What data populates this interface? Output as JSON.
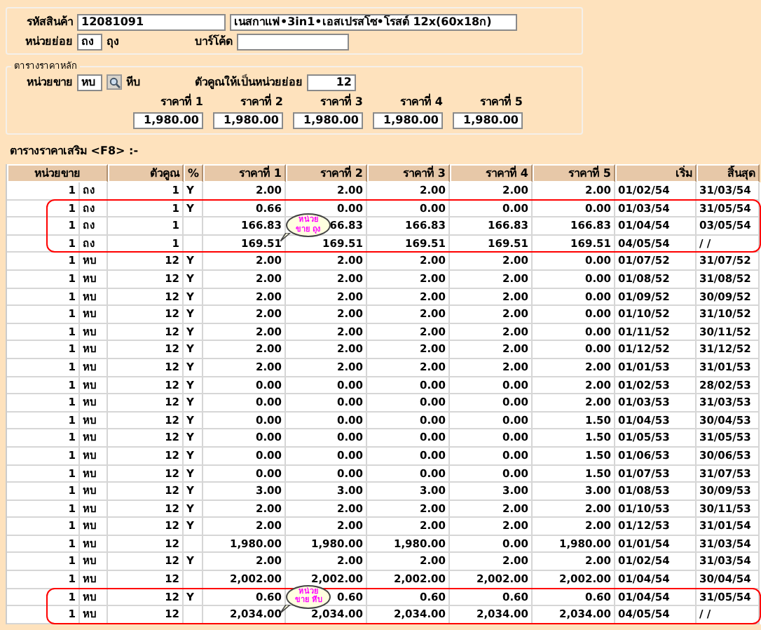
{
  "product": {
    "code_label": "รหัสสินค้า",
    "code": "12081091",
    "name": "เนสกาแฟ•3in1•เอสเปรสโซ•โรสต์ 12x(60x18ก)",
    "subunit_label": "หน่วยย่อย",
    "subunit_code": "ถง",
    "subunit_name": "ถุง",
    "barcode_label": "บาร์โค้ด"
  },
  "main_price": {
    "legend": "ตารางราคาหลัก",
    "unit_label": "หน่วยขาย",
    "unit_code": "หบ",
    "unit_name": "หีบ",
    "multiplier_label": "ตัวคูณให้เป็นหน่วยย่อย",
    "multiplier": "12",
    "prices": [
      {
        "label": "ราคาที่ 1",
        "value": "1,980.00"
      },
      {
        "label": "ราคาที่ 2",
        "value": "1,980.00"
      },
      {
        "label": "ราคาที่ 3",
        "value": "1,980.00"
      },
      {
        "label": "ราคาที่ 4",
        "value": "1,980.00"
      },
      {
        "label": "ราคาที่ 5",
        "value": "1,980.00"
      }
    ]
  },
  "extra_title": "ตารางราคาเสริม <F8> :-",
  "table": {
    "columns": [
      "หน่วยขาย",
      "ตัวคูณ",
      "%",
      "ราคาที่ 1",
      "ราคาที่ 2",
      "ราคาที่ 3",
      "ราคาที่ 4",
      "ราคาที่ 5",
      "เริ่ม",
      "สิ้นสุด"
    ],
    "rows": [
      {
        "qty": "1",
        "unit": "ถง",
        "mult": "1",
        "pct": "Y",
        "p": [
          "2.00",
          "2.00",
          "2.00",
          "2.00",
          "2.00"
        ],
        "start": "01/02/54",
        "end": "31/03/54",
        "outlined": false
      },
      {
        "qty": "1",
        "unit": "ถง",
        "mult": "1",
        "pct": "Y",
        "p": [
          "0.66",
          "0.00",
          "0.00",
          "0.00",
          "0.00"
        ],
        "start": "01/03/54",
        "end": "31/05/54",
        "outlined": true
      },
      {
        "qty": "1",
        "unit": "ถง",
        "mult": "1",
        "p": [
          "166.83",
          "66.83",
          "166.83",
          "166.83",
          "166.83"
        ],
        "start": "01/04/54",
        "end": "03/05/54",
        "outlined": true
      },
      {
        "qty": "1",
        "unit": "ถง",
        "mult": "1",
        "p": [
          "169.51",
          "169.51",
          "169.51",
          "169.51",
          "169.51"
        ],
        "start": "04/05/54",
        "end": "/  /",
        "outlined": true
      },
      {
        "qty": "1",
        "unit": "หบ",
        "mult": "12",
        "pct": "Y",
        "p": [
          "2.00",
          "2.00",
          "2.00",
          "2.00",
          "0.00"
        ],
        "start": "01/07/52",
        "end": "31/07/52",
        "outlined": false
      },
      {
        "qty": "1",
        "unit": "หบ",
        "mult": "12",
        "pct": "Y",
        "p": [
          "2.00",
          "2.00",
          "2.00",
          "2.00",
          "0.00"
        ],
        "start": "01/08/52",
        "end": "31/08/52",
        "outlined": false
      },
      {
        "qty": "1",
        "unit": "หบ",
        "mult": "12",
        "pct": "Y",
        "p": [
          "2.00",
          "2.00",
          "2.00",
          "2.00",
          "0.00"
        ],
        "start": "01/09/52",
        "end": "30/09/52",
        "outlined": false
      },
      {
        "qty": "1",
        "unit": "หบ",
        "mult": "12",
        "pct": "Y",
        "p": [
          "2.00",
          "2.00",
          "2.00",
          "2.00",
          "0.00"
        ],
        "start": "01/10/52",
        "end": "31/10/52",
        "outlined": false
      },
      {
        "qty": "1",
        "unit": "หบ",
        "mult": "12",
        "pct": "Y",
        "p": [
          "2.00",
          "2.00",
          "2.00",
          "2.00",
          "0.00"
        ],
        "start": "01/11/52",
        "end": "30/11/52",
        "outlined": false
      },
      {
        "qty": "1",
        "unit": "หบ",
        "mult": "12",
        "pct": "Y",
        "p": [
          "2.00",
          "2.00",
          "2.00",
          "2.00",
          "0.00"
        ],
        "start": "01/12/52",
        "end": "31/12/52",
        "outlined": false
      },
      {
        "qty": "1",
        "unit": "หบ",
        "mult": "12",
        "pct": "Y",
        "p": [
          "2.00",
          "2.00",
          "2.00",
          "2.00",
          "2.00"
        ],
        "start": "01/01/53",
        "end": "31/01/53",
        "outlined": false
      },
      {
        "qty": "1",
        "unit": "หบ",
        "mult": "12",
        "pct": "Y",
        "p": [
          "0.00",
          "0.00",
          "0.00",
          "0.00",
          "2.00"
        ],
        "start": "01/02/53",
        "end": "28/02/53",
        "outlined": false
      },
      {
        "qty": "1",
        "unit": "หบ",
        "mult": "12",
        "pct": "Y",
        "p": [
          "0.00",
          "0.00",
          "0.00",
          "0.00",
          "2.00"
        ],
        "start": "01/03/53",
        "end": "31/03/53",
        "outlined": false
      },
      {
        "qty": "1",
        "unit": "หบ",
        "mult": "12",
        "pct": "Y",
        "p": [
          "0.00",
          "0.00",
          "0.00",
          "0.00",
          "1.50"
        ],
        "start": "01/04/53",
        "end": "30/04/53",
        "outlined": false
      },
      {
        "qty": "1",
        "unit": "หบ",
        "mult": "12",
        "pct": "Y",
        "p": [
          "0.00",
          "0.00",
          "0.00",
          "0.00",
          "1.50"
        ],
        "start": "01/05/53",
        "end": "31/05/53",
        "outlined": false
      },
      {
        "qty": "1",
        "unit": "หบ",
        "mult": "12",
        "pct": "Y",
        "p": [
          "0.00",
          "0.00",
          "0.00",
          "0.00",
          "1.50"
        ],
        "start": "01/06/53",
        "end": "30/06/53",
        "outlined": false
      },
      {
        "qty": "1",
        "unit": "หบ",
        "mult": "12",
        "pct": "Y",
        "p": [
          "0.00",
          "0.00",
          "0.00",
          "0.00",
          "1.50"
        ],
        "start": "01/07/53",
        "end": "31/07/53",
        "outlined": false
      },
      {
        "qty": "1",
        "unit": "หบ",
        "mult": "12",
        "pct": "Y",
        "p": [
          "3.00",
          "3.00",
          "3.00",
          "3.00",
          "3.00"
        ],
        "start": "01/08/53",
        "end": "30/09/53",
        "outlined": false
      },
      {
        "qty": "1",
        "unit": "หบ",
        "mult": "12",
        "pct": "Y",
        "p": [
          "2.00",
          "2.00",
          "2.00",
          "2.00",
          "2.00"
        ],
        "start": "01/10/53",
        "end": "30/11/53",
        "outlined": false
      },
      {
        "qty": "1",
        "unit": "หบ",
        "mult": "12",
        "pct": "Y",
        "p": [
          "2.00",
          "2.00",
          "2.00",
          "2.00",
          "2.00"
        ],
        "start": "01/12/53",
        "end": "31/01/54",
        "outlined": false
      },
      {
        "qty": "1",
        "unit": "หบ",
        "mult": "12",
        "p": [
          "1,980.00",
          "1,980.00",
          "1,980.00",
          "0.00",
          "1,980.00"
        ],
        "start": "01/01/54",
        "end": "31/03/54",
        "outlined": false
      },
      {
        "qty": "1",
        "unit": "หบ",
        "mult": "12",
        "pct": "Y",
        "p": [
          "2.00",
          "2.00",
          "2.00",
          "2.00",
          "2.00"
        ],
        "start": "01/02/54",
        "end": "31/03/54",
        "outlined": false
      },
      {
        "qty": "1",
        "unit": "หบ",
        "mult": "12",
        "p": [
          "2,002.00",
          "2,002.00",
          "2,002.00",
          "2,002.00",
          "2,002.00"
        ],
        "start": "01/04/54",
        "end": "30/04/54",
        "outlined": false
      },
      {
        "qty": "1",
        "unit": "หบ",
        "mult": "12",
        "pct": "Y",
        "p": [
          "0.60",
          "0.60",
          "0.60",
          "0.60",
          "0.60"
        ],
        "start": "01/04/54",
        "end": "31/05/54",
        "outlined": true
      },
      {
        "qty": "1",
        "unit": "หบ",
        "mult": "12",
        "p": [
          "2,034.00",
          "2,034.00",
          "2,034.00",
          "2,034.00",
          "2,034.00"
        ],
        "start": "04/05/54",
        "end": "/  /",
        "outlined": true
      }
    ]
  },
  "callouts": [
    "หน่วย ขาย ถุง",
    "หน่วย ขาย หีบ"
  ]
}
